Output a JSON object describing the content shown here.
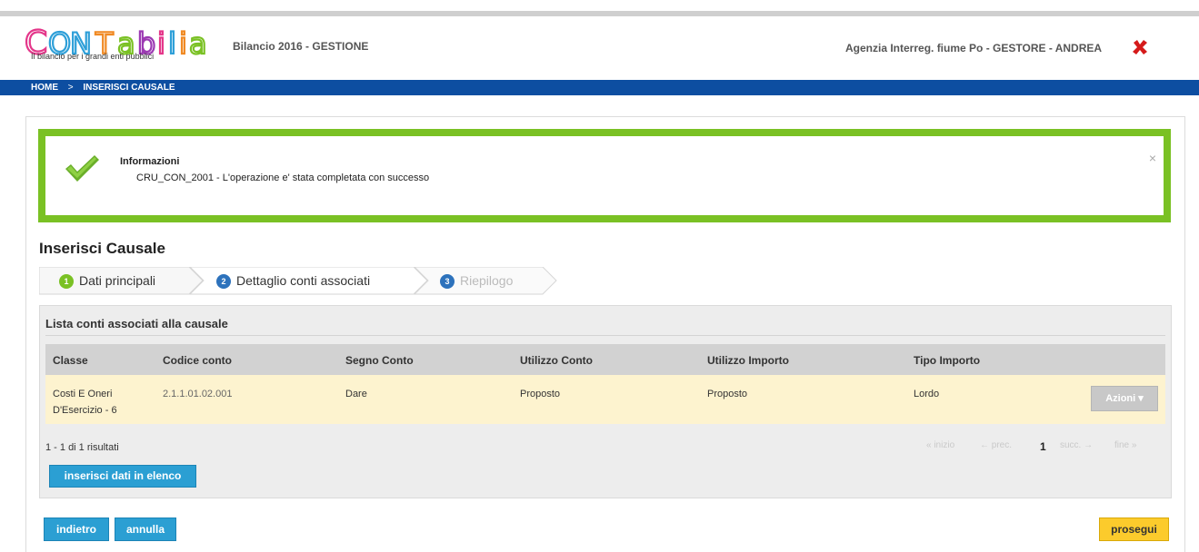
{
  "header": {
    "logo_text": "CoNTabilia",
    "logo_tagline": "Il bilancio per i grandi enti pubblici",
    "app_title": "Bilancio 2016 - GESTIONE",
    "user_info": "Agenzia Interreg. fiume Po - GESTORE - ANDREA"
  },
  "breadcrumb": {
    "home": "HOME",
    "separator": ">",
    "current": "INSERISCI CAUSALE"
  },
  "alert": {
    "title": "Informazioni",
    "message": "CRU_CON_2001 - L'operazione e' stata completata con successo",
    "close": "×"
  },
  "page_title": "Inserisci Causale",
  "wizard": {
    "steps": [
      {
        "num": "1",
        "label": "Dati principali",
        "state": "done"
      },
      {
        "num": "2",
        "label": "Dettaglio conti associati",
        "state": "active"
      },
      {
        "num": "3",
        "label": "Riepilogo",
        "state": "disabled"
      }
    ]
  },
  "list": {
    "title": "Lista conti associati alla causale",
    "columns": [
      "Classe",
      "Codice conto",
      "Segno Conto",
      "Utilizzo Conto",
      "Utilizzo Importo",
      "Tipo Importo"
    ],
    "rows": [
      {
        "classe_1": "Costi E Oneri",
        "classe_2": "D'Esercizio - 6",
        "codice": "2.1.1.01.02.001",
        "segno": "Dare",
        "utilizzo_conto": "Proposto",
        "utilizzo_importo": "Proposto",
        "tipo_importo": "Lordo",
        "action_label": "Azioni"
      }
    ],
    "results": "1 - 1 di 1 risultati",
    "pager": {
      "first": "« inizio",
      "prev": "← prec.",
      "current": "1",
      "next": "succ. →",
      "last": "fine »"
    },
    "insert_button": "inserisci dati in elenco"
  },
  "footer": {
    "back": "indietro",
    "cancel": "annulla",
    "next": "prosegui"
  },
  "colors": {
    "brand_blue": "#0d4ea1",
    "success_green": "#7ac124",
    "button_blue": "#2b9fd3",
    "button_yellow": "#fccb2c",
    "row_highlight": "#fdf3cf"
  },
  "icons": {
    "logout": "close-x-icon",
    "success": "checkmark-icon"
  }
}
